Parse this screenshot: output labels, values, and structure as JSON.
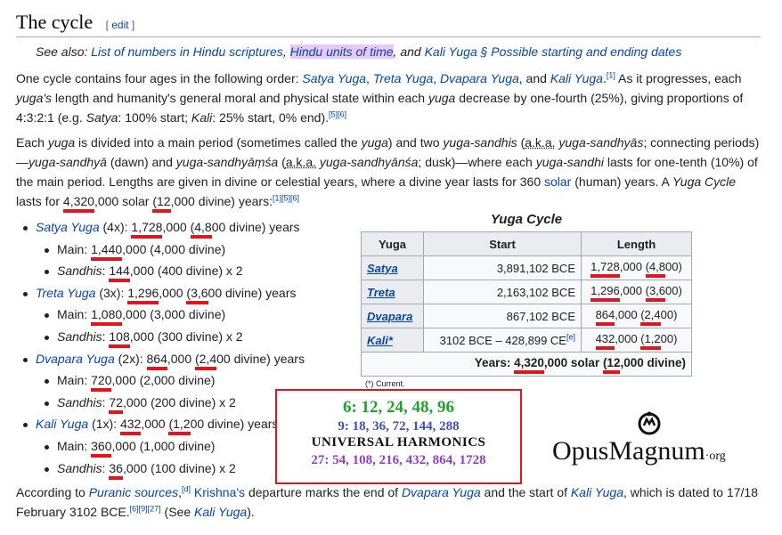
{
  "heading": {
    "title": "The cycle",
    "edit_open": "[ ",
    "edit": "edit",
    "edit_close": " ]"
  },
  "hatnote": {
    "prefix": "See also: ",
    "link1": "List of numbers in Hindu scriptures",
    "sep1": ", ",
    "link2": "Hindu units of time",
    "sep2": ", and ",
    "link3": "Kali Yuga § Possible starting and ending dates"
  },
  "p1": {
    "t1": "One cycle contains four ages in the following order: ",
    "satya": "Satya Yuga",
    "c1": ", ",
    "treta": "Treta Yuga",
    "c2": ", ",
    "dvapara": "Dvapara Yuga",
    "c3": ", and ",
    "kali": "Kali Yuga",
    "t2": ".",
    "ref1": "[1]",
    "t3": " As it progresses, each ",
    "yugas": "yuga's",
    "t4": " length and humanity's general moral and physical state within each ",
    "yuga": "yuga",
    "t5": " decrease by one-fourth (25%), giving proportions of 4:3:2:1 (e.g. ",
    "satya_i": "Satya",
    "t6": ": 100% start; ",
    "kali_i": "Kali",
    "t7": ": 25% start, 0% end).",
    "ref2": "[5][6]"
  },
  "p2": {
    "t1": "Each ",
    "yuga": "yuga",
    "t2": " is divided into a main period (sometimes called the ",
    "yuga2": "yuga",
    "t3": ") and two ",
    "ys": "yuga-sandhis",
    "t4": " (",
    "aka": "a.k.a.",
    "t5": " ",
    "ysy": "yuga-sandhyās",
    "t6": "; connecting periods)—",
    "ysd": "yuga-sandhyā",
    "t7": " (dawn) and ",
    "ysm": "yuga-sandhyāṃśa",
    "t8": " (",
    "aka2": "a.k.a.",
    "t9": " ",
    "ysn": "yuga-sandhyānśa",
    "t10": "; dusk)—where each ",
    "ysa": "yuga-sandhi",
    "t11": " lasts for one-tenth (10%) of the main period. Lengths are given in divine or celestial years, where a divine year lasts for 360 ",
    "solar": "solar",
    "t12": " (human) years. A ",
    "yc": "Yuga Cycle",
    "t13": " lasts for ",
    "n1": "4,320",
    "n1b": ",000 solar ",
    "n2": "(12",
    "n2b": ",000 divine) years:",
    "ref": "[1][5][6]"
  },
  "list": [
    {
      "kind": "main",
      "link": "Satya Yuga",
      "mult": " (4x): ",
      "a": "1,728",
      "b": ",000 ",
      "c": "(4,8",
      "d": "00 divine) years"
    },
    {
      "kind": "sub",
      "label": "Main: ",
      "a": "1,440",
      "rest": ",000 (4,000 divine)"
    },
    {
      "kind": "sub",
      "label": "Sandhis",
      "colon": ": ",
      "a": "144",
      "rest": ",000 (400 divine) x 2"
    },
    {
      "kind": "main",
      "link": "Treta Yuga",
      "mult": " (3x): ",
      "a": "1,296",
      "b": ",000 ",
      "c": "(3,6",
      "d": "00 divine) years"
    },
    {
      "kind": "sub",
      "label": "Main: ",
      "a": "1,080",
      "rest": ",000 (3,000 divine)"
    },
    {
      "kind": "sub",
      "label": "Sandhis",
      "colon": ": ",
      "a": "108",
      "rest": ",000 (300 divine) x 2"
    },
    {
      "kind": "main",
      "link": "Dvapara Yuga",
      "mult": " (2x): ",
      "a": "864",
      "b": ",000 ",
      "c": "(2,4",
      "d": "00 divine) years"
    },
    {
      "kind": "sub",
      "label": "Main: ",
      "a": "720",
      "rest": ",000 (2,000 divine)"
    },
    {
      "kind": "sub",
      "label": "Sandhis",
      "colon": ": ",
      "a": "72",
      "rest": ",000 (200 divine) x 2"
    },
    {
      "kind": "main",
      "link": "Kali Yuga",
      "mult": " (1x): ",
      "a": "432",
      "b": ",000 ",
      "c": "(1,2",
      "d": "00 divine) years"
    },
    {
      "kind": "sub",
      "label": "Main: ",
      "a": "360",
      "rest": ",000 (1,000 divine)"
    },
    {
      "kind": "sub",
      "label": "Sandhis",
      "colon": ": ",
      "a": "36",
      "rest": ",000 (100 divine) x 2"
    }
  ],
  "table": {
    "caption": "Yuga Cycle",
    "headers": [
      "Yuga",
      "Start",
      "Length"
    ],
    "rows": [
      {
        "yuga": "Satya",
        "start": "3,891,102 BCE",
        "len_a": "1,728",
        "len_b": ",000 ",
        "len_c": "(4,8",
        "len_d": "00)"
      },
      {
        "yuga": "Treta",
        "start": "2,163,102 BCE",
        "len_a": "1,296",
        "len_b": ",000 ",
        "len_c": "(3,6",
        "len_d": "00)"
      },
      {
        "yuga": "Dvapara",
        "start": "867,102 BCE",
        "len_a": "864",
        "len_b": ",000 ",
        "len_c": "(2,4",
        "len_d": "00)"
      },
      {
        "yuga": "Kali*",
        "start": "3102 BCE – 428,899 CE",
        "ref": "[e]",
        "len_a": "432",
        "len_b": ",000 ",
        "len_c": "(1,2",
        "len_d": "00)"
      }
    ],
    "total": {
      "label": "Years: ",
      "a": "4,320",
      "b": ",000 solar ",
      "c": "(12",
      "d": ",000 divine)"
    },
    "footnote": "(*) Current."
  },
  "overlay": {
    "line6": "6: 12, 24, 48, 96",
    "line9": "9: 18, 36, 72, 144, 288",
    "title": "UNIVERSAL HARMONICS",
    "line27": "27: 54, 108, 216, 432, 864, 1728"
  },
  "logo": {
    "name": "OpusMagnum",
    "suffix": "·org"
  },
  "p3": {
    "t1": "According to ",
    "puranic": "Puranic sources",
    "t2": ",",
    "refd": "[d]",
    "t3": " ",
    "krishna": "Krishna's",
    "t4": " departure marks the end of ",
    "dvapara": "Dvapara Yuga",
    "t5": " and the start of ",
    "kali": "Kali Yuga",
    "t6": ", which is dated to 17/18 February 3102 BCE.",
    "refs": "[6][9][27]",
    "t7": " (See ",
    "kali2": "Kali Yuga",
    "t8": ")."
  },
  "colors": {
    "link": "#0645ad",
    "underline": "#e8121c",
    "green": "#1fa32a",
    "blue": "#3a4fc8",
    "purple": "#8e3fc7",
    "highlight": "#e9c9f3"
  }
}
